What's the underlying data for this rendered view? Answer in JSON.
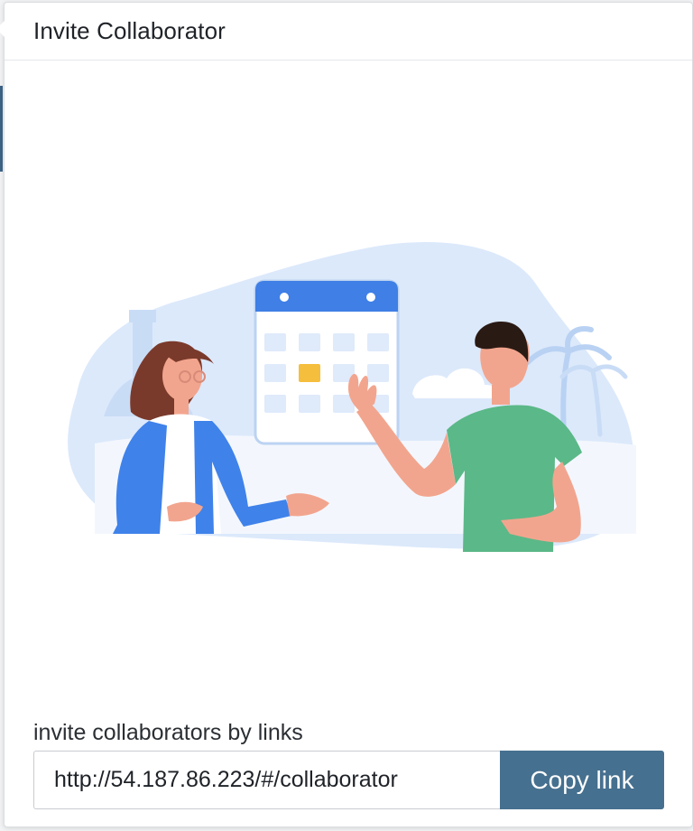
{
  "dialog": {
    "title": "Invite Collaborator"
  },
  "invite": {
    "label": "invite collaborators by links",
    "link_value": "http://54.187.86.223/#/collaborator",
    "copy_button_label": "Copy link"
  },
  "illustration": {
    "icon": "collaboration-illustration",
    "colors": {
      "blob": "#dce9fb",
      "calendar_header": "#3f7fe6",
      "calendar_highlight": "#f5be3d",
      "woman_jacket": "#3f82ea",
      "man_shirt": "#5bb888",
      "skin": "#f2a58e",
      "hair_woman": "#7a3a2b",
      "hair_man": "#2a1a14"
    }
  },
  "colors": {
    "accent": "#46708f"
  }
}
